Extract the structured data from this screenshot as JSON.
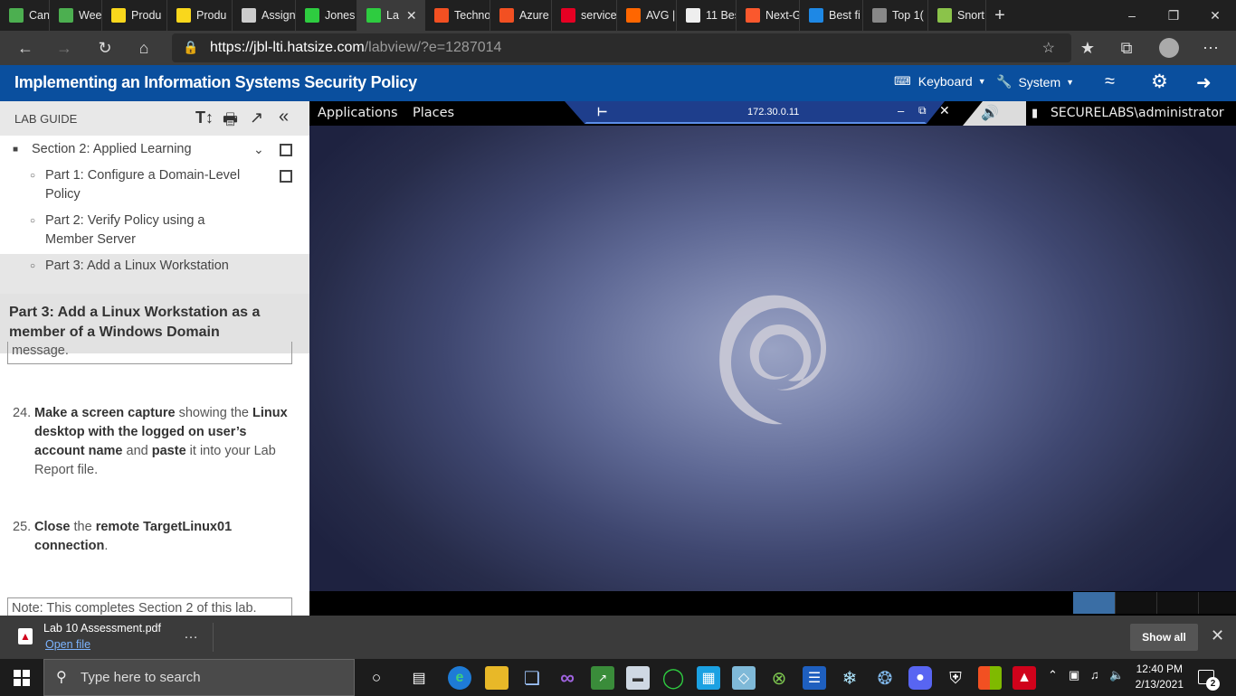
{
  "browser": {
    "tabs": [
      {
        "label": "Canva",
        "icon": "canvas-icon",
        "color": "#4caf50"
      },
      {
        "label": "Week",
        "icon": "canvas-icon",
        "color": "#4caf50"
      },
      {
        "label": "Produ",
        "icon": "flag-icon",
        "color": "#f9d71c"
      },
      {
        "label": "Produ",
        "icon": "flag-icon",
        "color": "#f9d71c"
      },
      {
        "label": "Assign",
        "icon": "document-icon",
        "color": "#cccccc"
      },
      {
        "label": "Jones",
        "icon": "leaf-icon",
        "color": "#2ecc40"
      },
      {
        "label": "La",
        "icon": "leaf-icon",
        "color": "#2ecc40",
        "active": true
      },
      {
        "label": "Techno",
        "icon": "microsoft-icon",
        "color": "#f25022"
      },
      {
        "label": "Azure",
        "icon": "microsoft-icon",
        "color": "#f25022"
      },
      {
        "label": "service",
        "icon": "pinterest-icon",
        "color": "#e60023"
      },
      {
        "label": "AVG |",
        "icon": "avg-icon",
        "color": "#ff6600"
      },
      {
        "label": "11 Bes",
        "icon": "bookmark-icon",
        "color": "#eeeeee"
      },
      {
        "label": "Next-G",
        "icon": "paloalto-icon",
        "color": "#fa582d"
      },
      {
        "label": "Best fi",
        "icon": "tr-icon",
        "color": "#1e88e5"
      },
      {
        "label": "Top 1(",
        "icon": "box-icon",
        "color": "#888888"
      },
      {
        "label": "Snort",
        "icon": "snort-icon",
        "color": "#8bc34a"
      }
    ],
    "new_tab": "+",
    "url_host": "https://jbl-lti.hatsize.com",
    "url_path": "/labview/?e=1287014"
  },
  "lab": {
    "title": "Implementing an Information Systems Security Policy",
    "keyboard_label": "Keyboard",
    "system_label": "System"
  },
  "guide": {
    "header_label": "LAB GUIDE",
    "section_label": "Section 2: Applied Learning",
    "parts": [
      "Part 1: Configure a Domain-Level Policy",
      "Part 2: Verify Policy using a Member Server",
      "Part 3: Add a Linux Workstation"
    ],
    "tooltip": "Part 3: Add a Linux Workstation as a member of a Windows Domain",
    "partial_box_text": "message.",
    "steps": [
      {
        "num": "24.",
        "html_parts": [
          "Make a screen capture",
          " showing the ",
          "Linux desktop with the logged on user’s account name",
          " and ",
          "paste",
          " it into your Lab Report file."
        ]
      },
      {
        "num": "25.",
        "html_parts": [
          "Close",
          " the ",
          "remote TargetLinux01 connection",
          "."
        ]
      }
    ],
    "note_partial": "Note: This completes Section 2 of this lab."
  },
  "remote": {
    "applications": "Applications",
    "places": "Places",
    "vnc_host": "172.30.0.11",
    "user": "SECURELABS\\administrator"
  },
  "download": {
    "filename": "Lab 10 Assessment.pdf",
    "open_link": "Open file",
    "more": "…",
    "show_all": "Show all"
  },
  "taskbar": {
    "search_placeholder": "Type here to search",
    "time": "12:40 PM",
    "date": "2/13/2021",
    "notifications": "2"
  }
}
